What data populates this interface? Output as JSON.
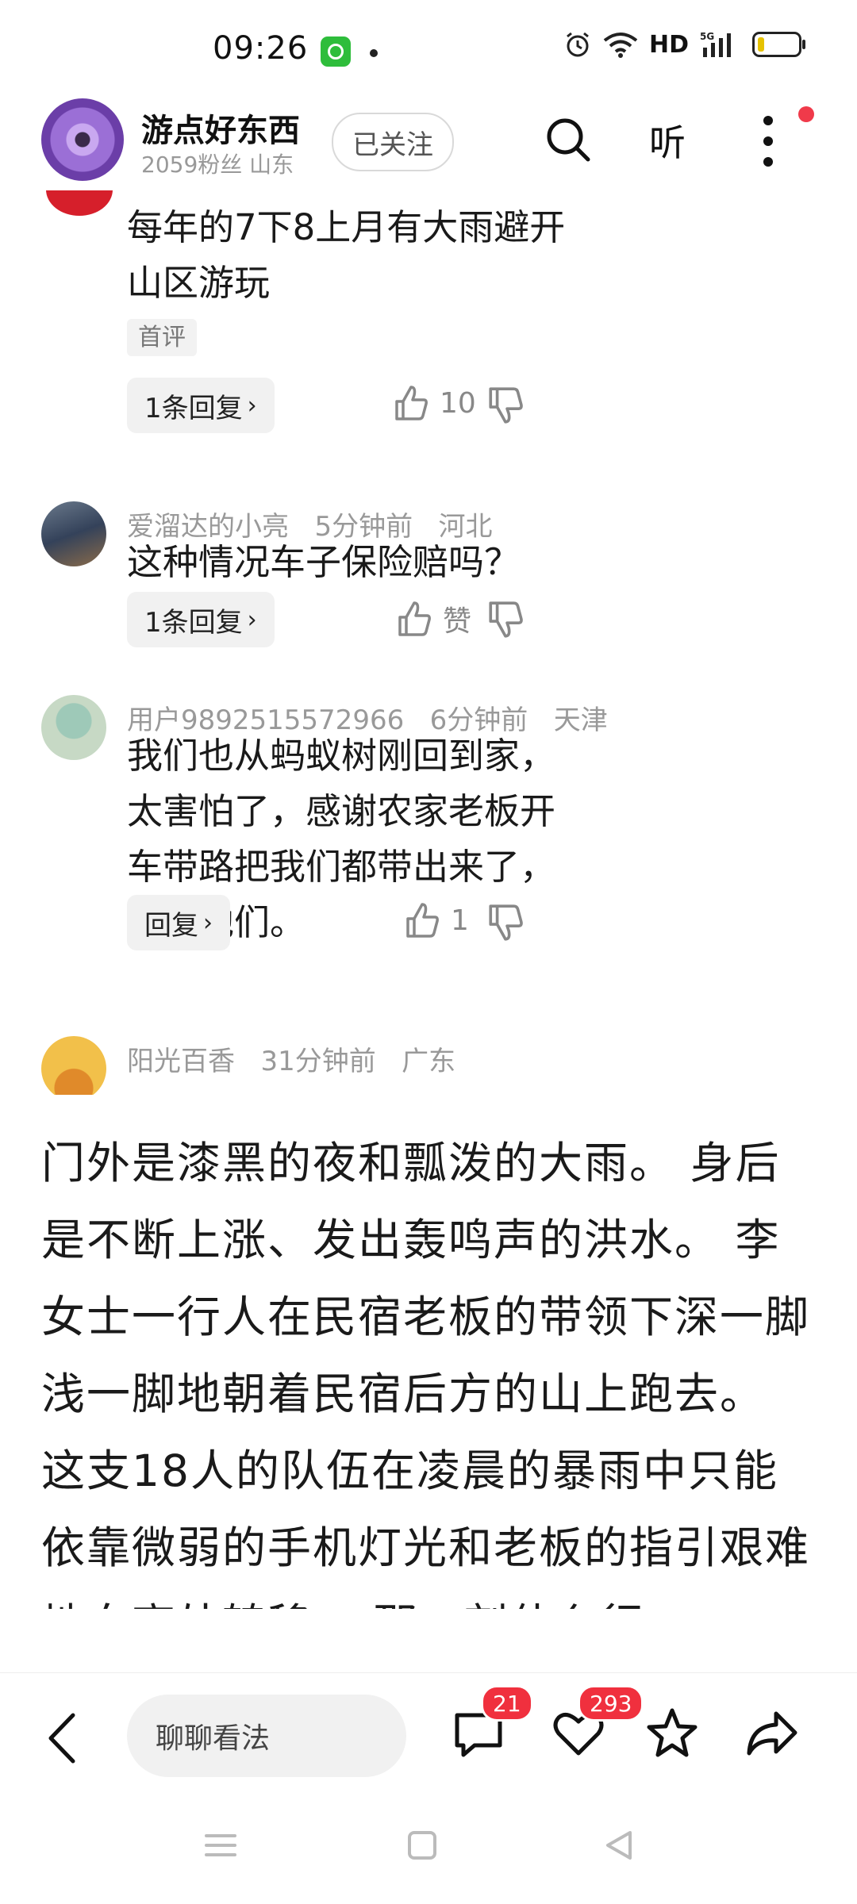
{
  "status_bar": {
    "time": "09:26",
    "network": "HD",
    "signal_label": "5G"
  },
  "header": {
    "author": "游点好东西",
    "meta": "2059粉丝  山东",
    "follow_label": "已关注",
    "listen_label": "听"
  },
  "comments": [
    {
      "text": "每年的7下8上月有大雨避开山区游玩",
      "tag": "首评",
      "reply_label": "1条回复",
      "likes": "10"
    },
    {
      "user": "爱溜达的小亮",
      "time": "5分钟前",
      "location": "河北",
      "text": "这种情况车子保险赔吗？",
      "reply_label": "1条回复",
      "likes": "赞"
    },
    {
      "user": "用户9892515572966",
      "time": "6分钟前",
      "location": "天津",
      "text": "我们也从蚂蚁树刚回到家，太害怕了，感谢农家老板开车带路把我们都带出来了，谢谢他们。",
      "reply_label": "回复",
      "likes": "1"
    },
    {
      "user": "阳光百香",
      "time": "31分钟前",
      "location": "广东"
    }
  ],
  "article": {
    "text": "门外是漆黑的夜和瓢泼的大雨。 身后是不断上涨、发出轰鸣声的洪水。 李女士一行人在民宿老板的带领下深一脚浅一脚地朝着民宿后方的山上跑去。 这支18人的队伍在凌晨的暴雨中只能依靠微弱的手机灯光和老板的指引艰难地向高处转移。 那一刻什么行"
  },
  "bottom_bar": {
    "input_placeholder": "聊聊看法",
    "comment_count": "21",
    "like_count": "293"
  },
  "colors": {
    "accent_red": "#f0303e",
    "text": "#1a1a1a",
    "muted": "#999999"
  }
}
